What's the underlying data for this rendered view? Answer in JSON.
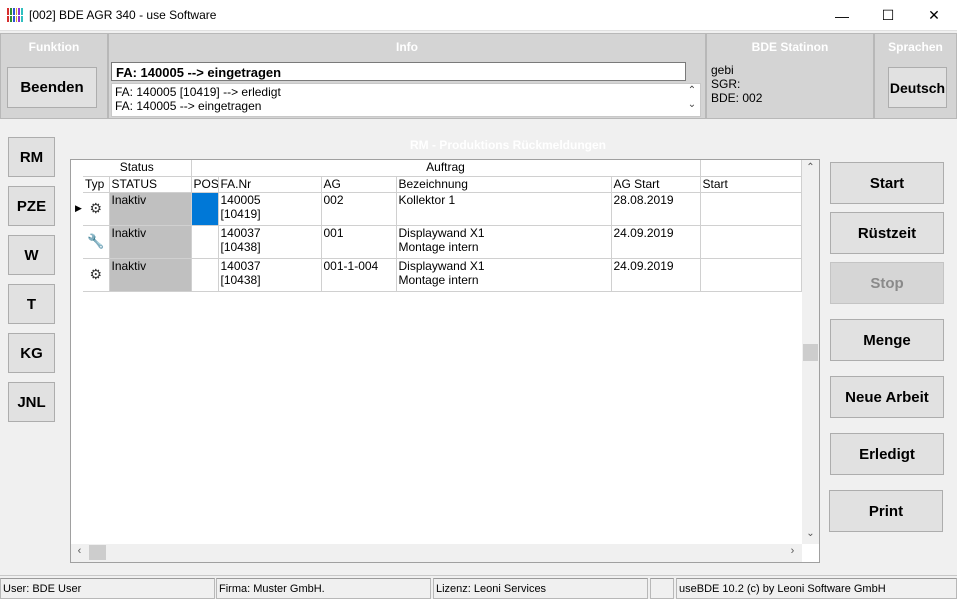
{
  "window": {
    "title": "[002] BDE AGR 340 - use Software",
    "minimize_glyph": "—",
    "maximize_glyph": "☐",
    "close_glyph": "✕",
    "icon_colors": [
      "#d62f2f",
      "#2f8f2f",
      "#2f4fd6",
      "#d6a92f",
      "#8f2fd6",
      "#2fbfbf"
    ]
  },
  "header": {
    "funktion_label": "Funktion",
    "beenden_label": "Beenden",
    "info_label": "Info",
    "info_current": "FA: 140005 --> eingetragen",
    "info_log": [
      "FA: 140005 [10419] --> erledigt",
      "FA: 140005 --> eingetragen"
    ],
    "info_scroll_up": "⌃",
    "info_scroll_down": "⌄",
    "station_label": "BDE Statinon",
    "station_lines": [
      "gebi",
      "SGR:",
      "BDE: 002"
    ],
    "sprachen_label": "Sprachen",
    "language_button": "Deutsch"
  },
  "left_nav": [
    "RM",
    "PZE",
    "W",
    "T",
    "KG",
    "JNL"
  ],
  "section_title": "RM - Produktions Rückmeldungen",
  "grid": {
    "group_headers": {
      "status": "Status",
      "auftrag": "Auftrag"
    },
    "columns": [
      "Typ",
      "STATUS",
      "POS",
      "FA.Nr",
      "AG",
      "Bezeichnung",
      "AG Start",
      "Start"
    ],
    "rows": [
      {
        "marker": "▶",
        "typ_icon": "gear-icon",
        "typ_glyph": "⚙",
        "status": "Inaktiv",
        "pos": "",
        "fa_nr": "140005",
        "fa_sub": "[10419]",
        "ag": "002",
        "bez1": "Kollektor 1",
        "bez2": "",
        "ag_start": "28.08.2019",
        "start": ""
      },
      {
        "marker": "",
        "typ_icon": "wrench-icon",
        "typ_glyph": "🔧",
        "status": "Inaktiv",
        "pos": "",
        "fa_nr": "140037",
        "fa_sub": "[10438]",
        "ag": "001",
        "bez1": "Displaywand X1",
        "bez2": "Montage intern",
        "ag_start": "24.09.2019",
        "start": ""
      },
      {
        "marker": "",
        "typ_icon": "gear-icon",
        "typ_glyph": "⚙",
        "status": "Inaktiv",
        "pos": "",
        "fa_nr": "140037",
        "fa_sub": "[10438]",
        "ag": "001-1-004",
        "bez1": "Displaywand X1",
        "bez2": "Montage intern",
        "ag_start": "24.09.2019",
        "start": ""
      }
    ]
  },
  "right_actions": {
    "start": "Start",
    "ruestzeit": "Rüstzeit",
    "stop": "Stop",
    "menge": "Menge",
    "neue_arbeit": "Neue Arbeit",
    "erledigt": "Erledigt",
    "print": "Print"
  },
  "statusbar": {
    "user": "User: BDE User",
    "firma": "Firma: Muster GmbH.",
    "lizenz": "Lizenz: Leoni Services",
    "extra": "",
    "version": "useBDE 10.2 (c) by Leoni Software GmbH"
  },
  "colors": {
    "selection": "#0078d7",
    "status_cell": "#c0c0c0",
    "header_panel": "#d4d4d4"
  }
}
